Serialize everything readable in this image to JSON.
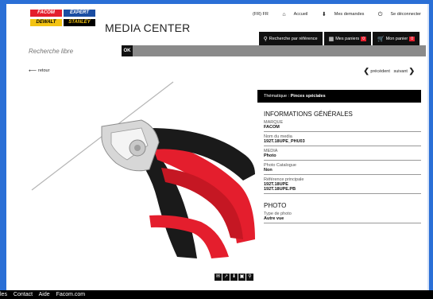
{
  "header": {
    "app_title": "MEDIA CENTER",
    "logos": [
      "FACOM",
      "EXPERT",
      "DEWALT",
      "STANLEY"
    ],
    "lang": "(FR) FR",
    "home": "Accueil",
    "downloads": "Mes demandes",
    "logout": "Se déconnecter"
  },
  "toolbar": {
    "ref_search": "Recherche par référence",
    "baskets": "Mes paniers",
    "baskets_count": "0",
    "basket": "Mon panier",
    "basket_count": "0"
  },
  "search": {
    "placeholder": "Recherche libre",
    "ok": "OK"
  },
  "nav": {
    "back": "retour",
    "prev": "précédent",
    "next": "suivant"
  },
  "panel": {
    "theme_label": "Thématique :",
    "theme_value": "Pinces spéciales",
    "general_title": "INFORMATIONS GÉNÉRALES",
    "fields": [
      {
        "label": "MARQUE",
        "value": "FACOM"
      },
      {
        "label": "Nom du media",
        "value": "192T.18UPE_PHU03"
      },
      {
        "label": "MEDIA",
        "value": "Photo"
      },
      {
        "label": "Photo Catalogue",
        "value": "Non"
      },
      {
        "label": "Référence principale",
        "value": "192T.18UPE"
      },
      {
        "label": "",
        "value": "192T.18UPE.PB"
      }
    ],
    "photo_title": "PHOTO",
    "photo_fields": [
      {
        "label": "Type de photo",
        "value": "Autre vue"
      }
    ]
  },
  "footer": {
    "links": [
      "les",
      "Contact",
      "Aide",
      "Facom.com"
    ]
  },
  "icons": {
    "home": "home-icon",
    "download": "download-icon",
    "logout": "power-icon",
    "search": "search-icon",
    "grid": "grid-icon",
    "cart": "cart-icon"
  },
  "colors": {
    "accent_red": "#e41e2d",
    "dark": "#111111",
    "window_blue": "#2a6fd6"
  }
}
